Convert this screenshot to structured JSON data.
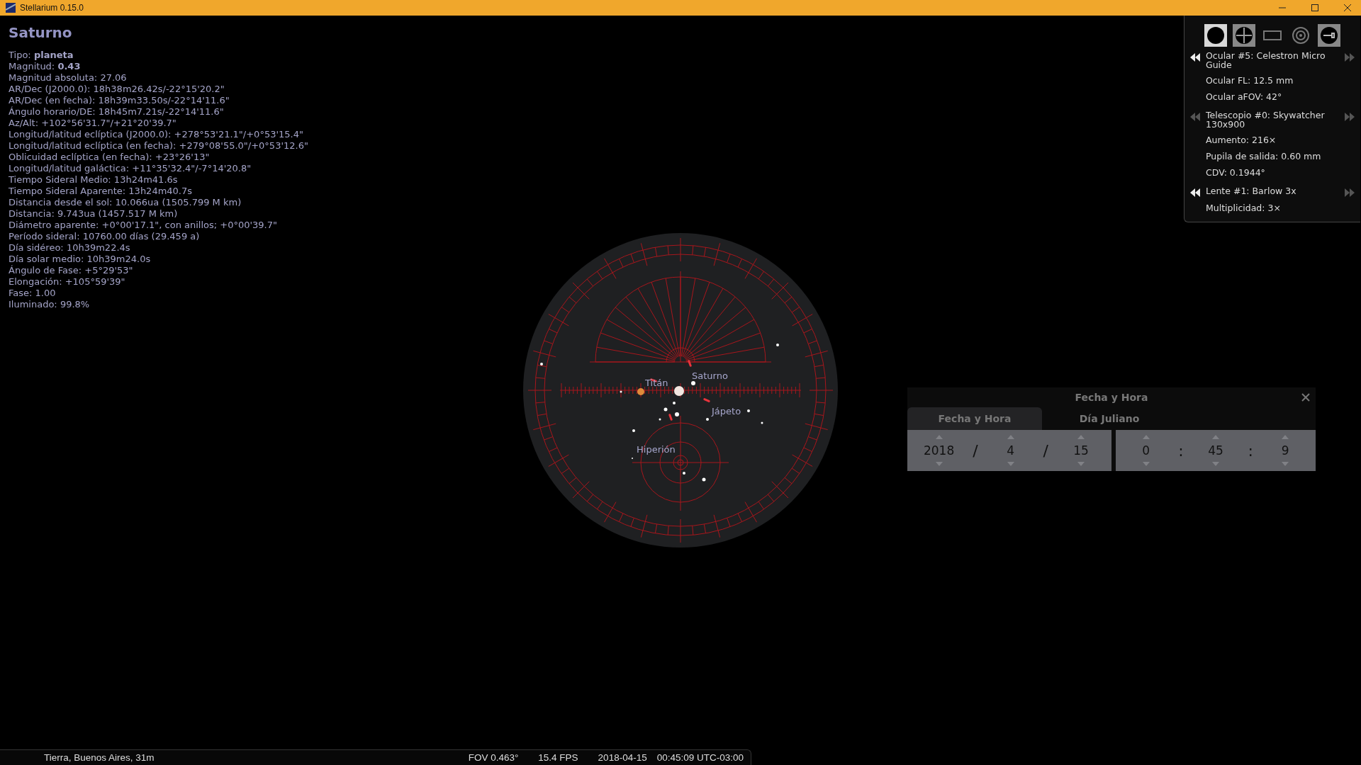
{
  "window": {
    "title": "Stellarium 0.15.0"
  },
  "object_info": {
    "name": "Saturno",
    "lines": [
      "Tipo: **planeta**",
      "Magnitud: **0.43**",
      "Magnitud absoluta: 27.06",
      "AR/Dec (J2000.0): 18h38m26.42s/-22°15'20.2\"",
      "AR/Dec (en fecha): 18h39m33.50s/-22°14'11.6\"",
      "Ángulo horario/DE: 18h45m7.21s/-22°14'11.6\"",
      "Az/Alt: +102°56'31.7\"/+21°20'39.7\"",
      "Longitud/latitud eclíptica (J2000.0): +278°53'21.1\"/+0°53'15.4\"",
      "Longitud/latitud eclíptica (en fecha): +279°08'55.0\"/+0°53'12.6\"",
      "Oblicuidad eclíptica (en fecha): +23°26'13\"",
      "Longitud/latitud galáctica: +11°35'32.4\"/-7°14'20.8\"",
      "Tiempo Sideral Medio: 13h24m41.6s",
      "Tiempo Sideral Aparente: 13h24m40.7s",
      "Distancia desde el sol: 10.066ua (1505.799 M km)",
      "Distancia: 9.743ua (1457.517 M km)",
      "Diámetro aparente: +0°00'17.1\", con anillos; +0°00'39.7\"",
      "Período sideral: 10760.00 días (29.459 a)",
      "Día sidéreo: 10h39m22.4s",
      "Día solar medio: 10h39m24.0s",
      "Ángulo de Fase: +5°29'53\"",
      "Elongación: +105°59'39\"",
      "Fase: 1.00",
      "Iluminado: 99.8%"
    ]
  },
  "sky_labels": [
    {
      "text": "Saturno"
    },
    {
      "text": "Titán"
    },
    {
      "text": "Jápeto"
    },
    {
      "text": "Hiperión"
    }
  ],
  "oculars_panel": {
    "tools": [
      {
        "kind": "disk",
        "selected": true,
        "on": true
      },
      {
        "kind": "crosshair",
        "selected": false,
        "on": true
      },
      {
        "kind": "rectangle",
        "selected": false,
        "on": false
      },
      {
        "kind": "target",
        "selected": false,
        "on": false
      },
      {
        "kind": "wrench",
        "selected": false,
        "on": true
      }
    ],
    "sections": [
      {
        "title": "Ocular #5: Celestron Micro Guide",
        "prev_enabled": true,
        "next_enabled": false,
        "details": [
          "Ocular FL: 12.5 mm",
          "Ocular aFOV: 42°"
        ]
      },
      {
        "title": "Telescopio #0: Skywatcher 130x900",
        "prev_enabled": false,
        "next_enabled": false,
        "details": [
          "Aumento: 216×",
          "Pupila de salida: 0.60 mm",
          "CDV: 0.1944°"
        ]
      },
      {
        "title": "Lente #1: Barlow 3x",
        "prev_enabled": true,
        "next_enabled": false,
        "details": [
          "Multiplicidad: 3×"
        ]
      }
    ]
  },
  "date_dialog": {
    "title": "Fecha y Hora",
    "tabs": [
      {
        "label": "Fecha y Hora",
        "selected": true
      },
      {
        "label": "Día Juliano",
        "selected": false
      }
    ],
    "date": [
      "2018",
      "4",
      "15"
    ],
    "date_separator": "/",
    "time": [
      "0",
      "45",
      "9"
    ],
    "time_separator": ":"
  },
  "status_bar": {
    "location": "Tierra, Buenos Aires, 31m",
    "fov": "FOV 0.463°",
    "fps": "15.4 FPS",
    "date": "2018-04-15",
    "time": "00:45:09 UTC-03:00"
  }
}
